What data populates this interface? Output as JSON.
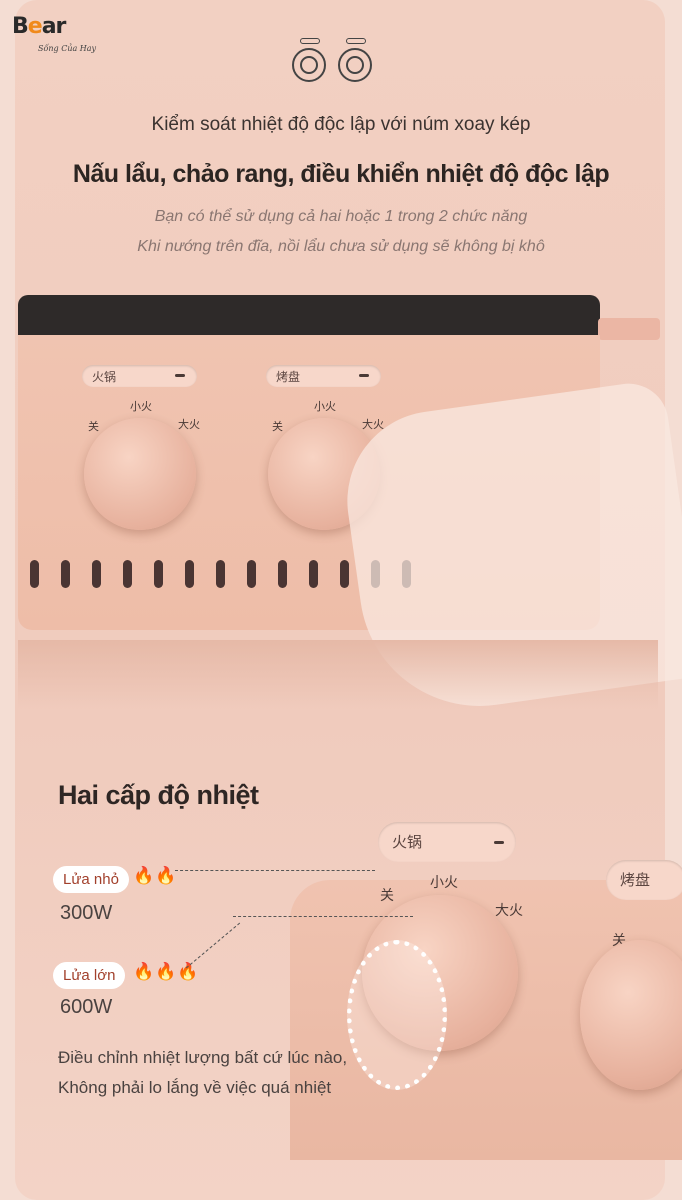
{
  "brand": {
    "logo": "Bear",
    "tagline": "Sống Của Hay"
  },
  "header": {
    "icon": "dual-knob-icon",
    "subtitle": "Kiểm soát nhiệt độ độc lập với núm xoay kép",
    "title": "Nấu lẩu, chảo rang, điều khiển nhiệt độ độc lập",
    "desc_lines": [
      "Bạn có thể sử dụng cả hai hoặc 1 trong 2 chức năng",
      "Khi nướng trên đĩa, nồi lẩu chưa sử dụng sẽ không bị khô"
    ]
  },
  "appliance": {
    "panel_hotpot": "火锅",
    "panel_grill": "烤盘",
    "off": "关",
    "low": "小火",
    "high": "大火"
  },
  "levels": {
    "heading": "Hai cấp độ nhiệt",
    "items": [
      {
        "label": "Lửa nhỏ",
        "flames": 2,
        "power": "300W"
      },
      {
        "label": "Lửa lớn",
        "flames": 3,
        "power": "600W"
      }
    ],
    "note_lines": [
      "Điều chỉnh nhiệt lượng bất cứ lúc nào,",
      "Không phải lo lắng về việc quá nhiệt"
    ]
  },
  "colors": {
    "background": "#f2d0c2",
    "flame": "#b8391f",
    "pill_text": "#a2402c"
  }
}
